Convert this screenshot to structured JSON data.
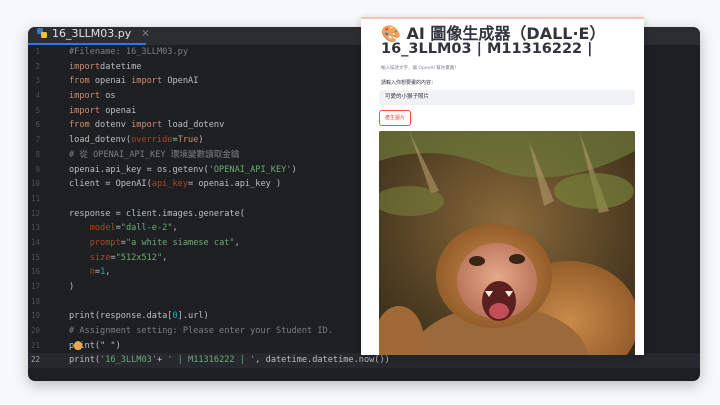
{
  "editor": {
    "tab": {
      "filename": "16_3LLM03.py",
      "close": "×"
    },
    "current_line_index": 21,
    "lines": [
      {
        "n": "1",
        "tokens": [
          [
            "cm",
            "#Filename: 16_3LLM03.py"
          ]
        ]
      },
      {
        "n": "2",
        "tokens": [
          [
            "kw",
            "import"
          ],
          [
            "",
            "datetime"
          ]
        ]
      },
      {
        "n": "3",
        "tokens": [
          [
            "kw",
            "from"
          ],
          [
            "",
            " openai "
          ],
          [
            "kw",
            "import"
          ],
          [
            "",
            " OpenAI"
          ]
        ]
      },
      {
        "n": "4",
        "tokens": [
          [
            "kw",
            "import"
          ],
          [
            "",
            " os"
          ]
        ]
      },
      {
        "n": "5",
        "tokens": [
          [
            "kw",
            "import"
          ],
          [
            "",
            " openai"
          ]
        ]
      },
      {
        "n": "6",
        "tokens": [
          [
            "kw",
            "from"
          ],
          [
            "",
            " dotenv "
          ],
          [
            "kw",
            "import"
          ],
          [
            "",
            " load_dotenv"
          ]
        ]
      },
      {
        "n": "7",
        "tokens": [
          [
            "",
            "load_dotenv("
          ],
          [
            "param",
            "override"
          ],
          [
            "",
            "="
          ],
          [
            "kw",
            "True"
          ],
          [
            "",
            ")"
          ]
        ]
      },
      {
        "n": "8",
        "tokens": [
          [
            "cm",
            "# 從 OPENAI_API_KEY 環境變數讀取金鑰"
          ]
        ]
      },
      {
        "n": "9",
        "tokens": [
          [
            "",
            "openai.api_key = os.getenv("
          ],
          [
            "str",
            "'OPENAI_API_KEY'"
          ],
          [
            "",
            ")"
          ]
        ]
      },
      {
        "n": "10",
        "tokens": [
          [
            "",
            "client = OpenAI("
          ],
          [
            "param",
            "api_key"
          ],
          [
            "",
            "= openai.api_key )"
          ]
        ]
      },
      {
        "n": "11",
        "tokens": []
      },
      {
        "n": "12",
        "tokens": [
          [
            "",
            "response = client.images.generate("
          ]
        ]
      },
      {
        "n": "13",
        "tokens": [
          [
            "",
            "    "
          ],
          [
            "param",
            "model"
          ],
          [
            "",
            "="
          ],
          [
            "str",
            "\"dall-e-2\""
          ],
          [
            "",
            ","
          ]
        ]
      },
      {
        "n": "14",
        "tokens": [
          [
            "",
            "    "
          ],
          [
            "param",
            "prompt"
          ],
          [
            "",
            "="
          ],
          [
            "str",
            "\"a white siamese cat\""
          ],
          [
            "",
            ","
          ]
        ]
      },
      {
        "n": "15",
        "tokens": [
          [
            "",
            "    "
          ],
          [
            "param",
            "size"
          ],
          [
            "",
            "="
          ],
          [
            "str",
            "\"512x512\""
          ],
          [
            "",
            ","
          ]
        ]
      },
      {
        "n": "16",
        "tokens": [
          [
            "",
            "    "
          ],
          [
            "param",
            "n"
          ],
          [
            "",
            "="
          ],
          [
            "num",
            "1"
          ],
          [
            "",
            ","
          ]
        ]
      },
      {
        "n": "17",
        "tokens": [
          [
            "",
            ")"
          ]
        ]
      },
      {
        "n": "18",
        "tokens": []
      },
      {
        "n": "19",
        "tokens": [
          [
            "",
            "print(response.data["
          ],
          [
            "num",
            "0"
          ],
          [
            "",
            "].url)"
          ]
        ]
      },
      {
        "n": "20",
        "tokens": [
          [
            "cm",
            "# Assignment setting: Please enter your Student ID."
          ]
        ]
      },
      {
        "n": "21",
        "tokens": [
          [
            "",
            "print(\" \")"
          ]
        ],
        "bulb": true
      },
      {
        "n": "22",
        "tokens": [
          [
            "",
            "print("
          ],
          [
            "str",
            "'16_3LLM03'"
          ],
          [
            "",
            "+ "
          ],
          [
            "str",
            "' | M11316222 | '"
          ],
          [
            "",
            ", datetime.datetime.now())"
          ]
        ]
      }
    ]
  },
  "app": {
    "title_emoji": "🎨",
    "title": "AI 圖像生成器（DALL·E）",
    "subtitle": "16_3LLM03 | M11316222 |",
    "caption": "輸入描述文字，讓 OpenAI 幫你畫圖！",
    "input_label": "請輸入你想要畫的內容：",
    "input_value": "可愛的小猴子照片",
    "button_label": "產生圖片",
    "image_name": "generated-monkey-image"
  },
  "colors": {
    "editor_bg": "#1e1f22",
    "keyword": "#cf8e6d",
    "string": "#6aab73",
    "comment": "#7a7e85",
    "param": "#aa4926",
    "number": "#2aacb8",
    "accent": "#ff4b4b"
  }
}
